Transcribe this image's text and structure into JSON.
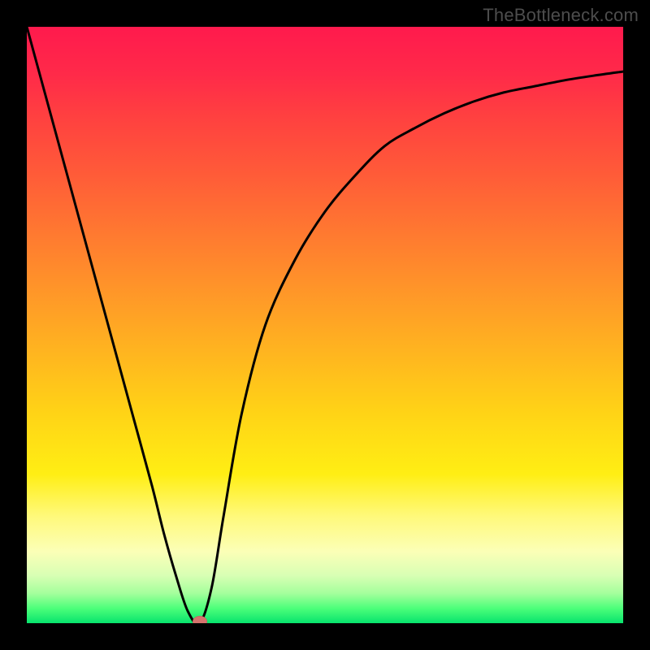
{
  "watermark": "TheBottleneck.com",
  "chart_data": {
    "type": "line",
    "title": "",
    "xlabel": "",
    "ylabel": "",
    "xlim": [
      0,
      100
    ],
    "ylim": [
      0,
      100
    ],
    "grid": false,
    "legend": false,
    "note": "Numeric values are estimated from pixel positions; the image has no visible axes, ticks, or numeric labels.",
    "series": [
      {
        "name": "curve",
        "x": [
          0,
          3,
          6,
          9,
          12,
          15,
          18,
          21,
          23,
          25,
          27,
          29,
          31,
          33,
          36,
          40,
          45,
          50,
          55,
          60,
          65,
          70,
          75,
          80,
          85,
          90,
          95,
          100
        ],
        "y": [
          100,
          89,
          78,
          67,
          56,
          45,
          34,
          23,
          15,
          8,
          2,
          0,
          6,
          18,
          35,
          50,
          61,
          69,
          75,
          80,
          83,
          85.5,
          87.5,
          89,
          90,
          91,
          91.8,
          92.5
        ]
      }
    ],
    "marker": {
      "x": 29,
      "y": 0,
      "color": "#d6736d"
    },
    "colors": {
      "curve": "#000000",
      "marker": "#d6736d",
      "frame": "#000000",
      "gradient_top": "#ff1a4d",
      "gradient_bottom": "#07e36d"
    }
  }
}
